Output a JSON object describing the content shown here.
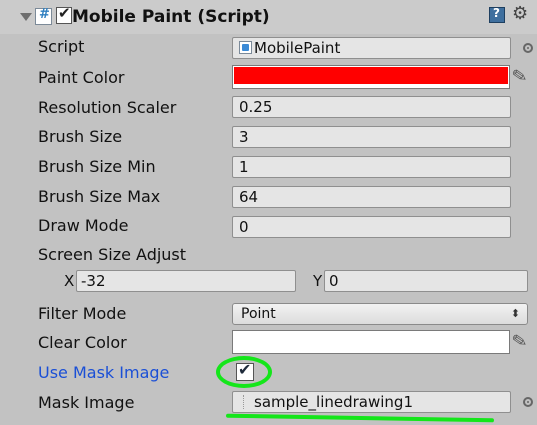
{
  "component": {
    "title": "Mobile Paint (Script)",
    "enabled": true
  },
  "fields": {
    "script": {
      "label": "Script",
      "value": "MobilePaint"
    },
    "paint_color": {
      "label": "Paint Color",
      "color": "#ff0000"
    },
    "resolution_scaler": {
      "label": "Resolution Scaler",
      "value": "0.25"
    },
    "brush_size": {
      "label": "Brush Size",
      "value": "3"
    },
    "brush_size_min": {
      "label": "Brush Size Min",
      "value": "1"
    },
    "brush_size_max": {
      "label": "Brush Size Max",
      "value": "64"
    },
    "draw_mode": {
      "label": "Draw Mode",
      "value": "0"
    },
    "screen_size_adjust": {
      "label": "Screen Size Adjust",
      "x_label": "X",
      "x_value": "-32",
      "y_label": "Y",
      "y_value": "0"
    },
    "filter_mode": {
      "label": "Filter Mode",
      "value": "Point"
    },
    "clear_color": {
      "label": "Clear Color",
      "color": "#ffffff"
    },
    "use_mask_image": {
      "label": "Use Mask Image",
      "checked": true
    },
    "mask_image": {
      "label": "Mask Image",
      "value": "sample_linedrawing1"
    }
  },
  "colors": {
    "background": "#c2c2c2",
    "modified_label": "#1a4fd6",
    "annotation": "#14e61a"
  }
}
